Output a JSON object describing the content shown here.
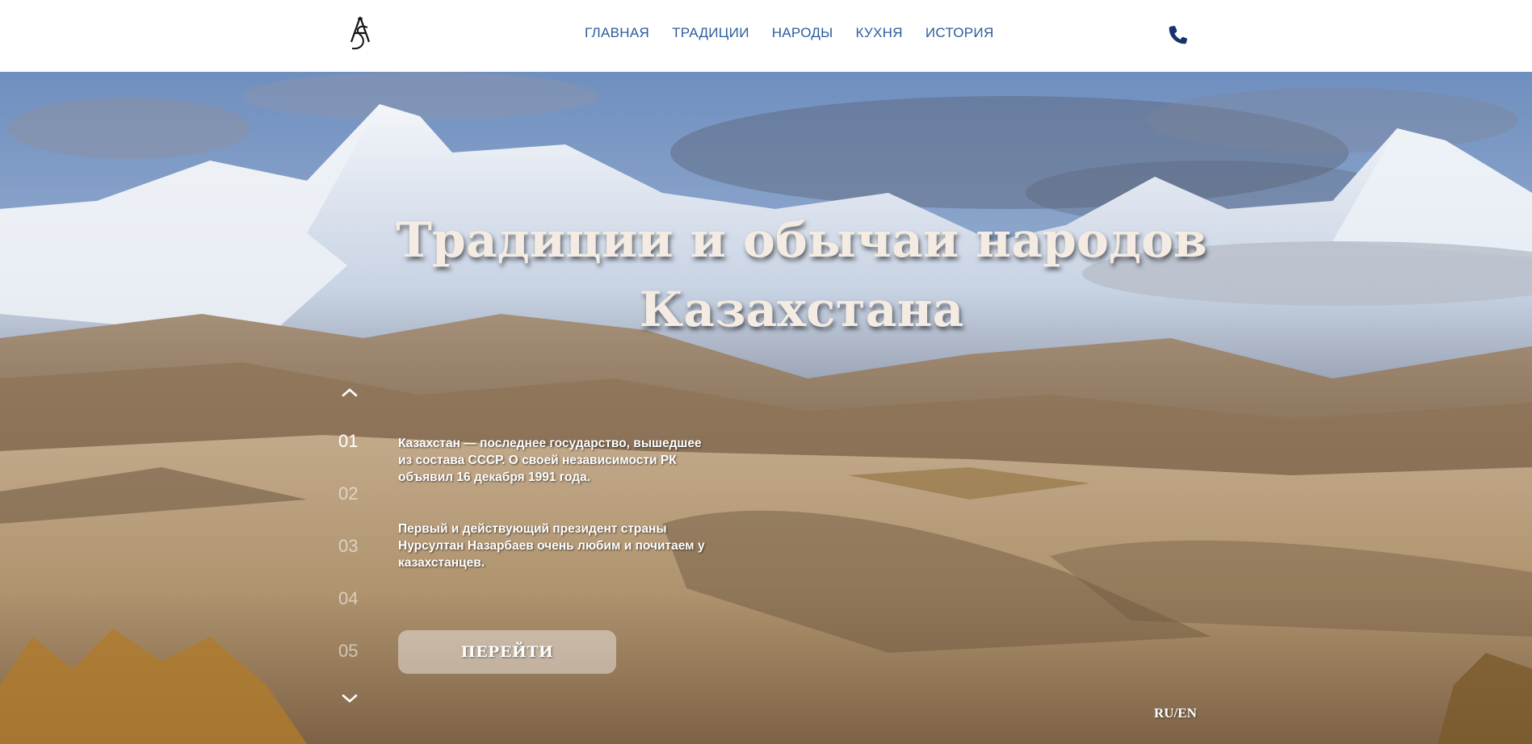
{
  "header": {
    "logo_icon": "monogram-logo-icon",
    "nav": [
      {
        "label": "ГЛАВНАЯ"
      },
      {
        "label": "ТРАДИЦИИ"
      },
      {
        "label": "НАРОДЫ"
      },
      {
        "label": "КУХНЯ"
      },
      {
        "label": "ИСТОРИЯ"
      }
    ],
    "phone_icon": "phone-icon",
    "nav_color": "#2a5d9c",
    "icon_color": "#16336d"
  },
  "hero": {
    "title_line1": "Традиции и обычаи народов",
    "title_line2": "Казахстана",
    "title_color": "#f4ebe3",
    "slider": {
      "up_icon": "chevron-up-icon",
      "down_icon": "chevron-down-icon",
      "numbers": [
        "01",
        "02",
        "03",
        "04",
        "05"
      ],
      "active": "01"
    },
    "paragraph1": "Казахстан — последнее государство, вышедшее из состава СССР. О своей независимости РК объявил 16 декабря 1991 года.",
    "paragraph2": "Первый и действующий президент страны Нурсултан Назарбаев очень любим и почитаем у казахстанцев.",
    "button_label": "ПЕРЕЙТИ",
    "language_switch": "RU/EN"
  }
}
